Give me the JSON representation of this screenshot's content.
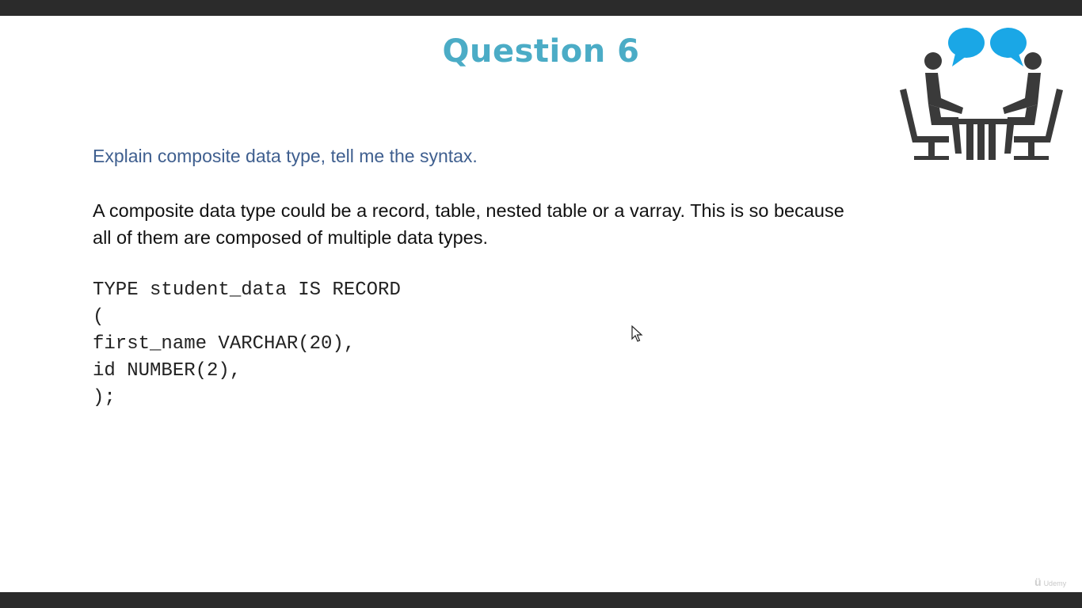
{
  "slide": {
    "title": "Question 6",
    "question": "Explain composite data type, tell me the syntax.",
    "answer": "A composite data type could be a record, table, nested table or a varray. This is so because all of them are composed of multiple data types.",
    "code_lines": [
      "TYPE student_data IS RECORD",
      "(",
      "first_name VARCHAR(20),",
      "id NUMBER(2),",
      ");"
    ],
    "illustration_icon": "two-people-talking-at-table-icon",
    "watermark": "Udemy"
  },
  "colors": {
    "title": "#4bacc6",
    "question": "#3f5f8f",
    "bubbles": "#1aa7e6",
    "figures": "#3a3a3a",
    "frame": "#2b2b2b"
  }
}
